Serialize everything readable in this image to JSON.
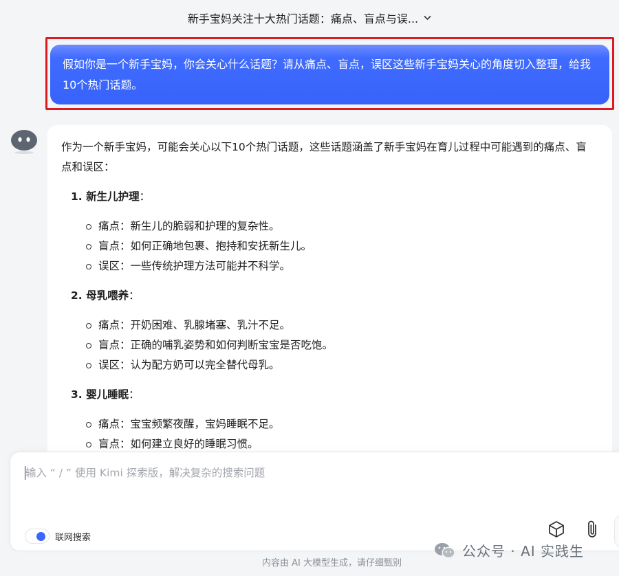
{
  "header": {
    "title": "新手宝妈关注十大热门话题：痛点、盲点与误..."
  },
  "user_message": "假如你是一个新手宝妈，你会关心什么话题？请从痛点、盲点，误区这些新手宝妈关心的角度切入整理，给我10个热门话题。",
  "bot_message": {
    "intro": "作为一个新手宝妈，可能会关心以下10个热门话题，这些话题涵盖了新手宝妈在育儿过程中可能遇到的痛点、盲点和误区：",
    "sections": [
      {
        "title": "1. 新生儿护理",
        "points": [
          "痛点：新生儿的脆弱和护理的复杂性。",
          "盲点：如何正确地包裹、抱持和安抚新生儿。",
          "误区：一些传统护理方法可能并不科学。"
        ]
      },
      {
        "title": "2. 母乳喂养",
        "points": [
          "痛点：开奶困难、乳腺堵塞、乳汁不足。",
          "盲点：正确的哺乳姿势和如何判断宝宝是否吃饱。",
          "误区：认为配方奶可以完全替代母乳。"
        ]
      },
      {
        "title": "3. 婴儿睡眠",
        "points": [
          "痛点：宝宝频繁夜醒，宝妈睡眠不足。",
          "盲点：如何建立良好的睡眠习惯。"
        ]
      }
    ]
  },
  "input": {
    "placeholder": "输入 “ / ” 使用 Kimi 探索版，解决复杂的搜索问题",
    "web_search_label": "联网搜索"
  },
  "watermark": "公众号 · AI 实践生",
  "footer_note": "内容由 AI 大模型生成，请仔细甄别",
  "colors": {
    "accent": "#3a66ff",
    "highlight_border": "#e0191f"
  }
}
